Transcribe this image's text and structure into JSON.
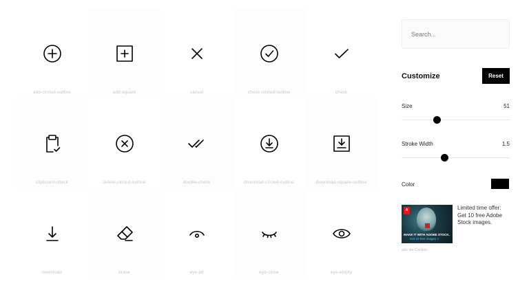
{
  "icons": [
    {
      "name": "add-circled-outline",
      "icon": "plus-circle-icon"
    },
    {
      "name": "add-square",
      "icon": "plus-square-icon"
    },
    {
      "name": "cancel",
      "icon": "x-icon"
    },
    {
      "name": "check-circled-outline",
      "icon": "check-circle-icon"
    },
    {
      "name": "check",
      "icon": "check-icon"
    },
    {
      "name": "clipboard-check",
      "icon": "clipboard-check-icon"
    },
    {
      "name": "delete-circled-outline",
      "icon": "x-circle-icon"
    },
    {
      "name": "double-check",
      "icon": "double-check-icon"
    },
    {
      "name": "download-circled-outline",
      "icon": "download-circle-icon"
    },
    {
      "name": "download-square-outline",
      "icon": "download-square-icon"
    },
    {
      "name": "download",
      "icon": "download-icon"
    },
    {
      "name": "erase",
      "icon": "eraser-icon"
    },
    {
      "name": "eye-alt",
      "icon": "eye-alt-icon"
    },
    {
      "name": "eye-close",
      "icon": "eye-closed-icon"
    },
    {
      "name": "eye-empty",
      "icon": "eye-icon"
    }
  ],
  "sidebar": {
    "search_placeholder": "Search...",
    "customize_title": "Customize",
    "reset_label": "Reset",
    "size": {
      "label": "Size",
      "value": "51",
      "position": 0.33
    },
    "stroke": {
      "label": "Stroke Width",
      "value": "1.5",
      "position": 0.4
    },
    "color": {
      "label": "Color",
      "value": "#000000"
    }
  },
  "ad": {
    "line1": "MAKE IT WITH ADOBE STOCK.",
    "line2": "Get 10 free images >",
    "logo": "A",
    "text": "Limited time offer: Get 10 free Adobe Stock images.",
    "via": "ads via Carbon"
  }
}
